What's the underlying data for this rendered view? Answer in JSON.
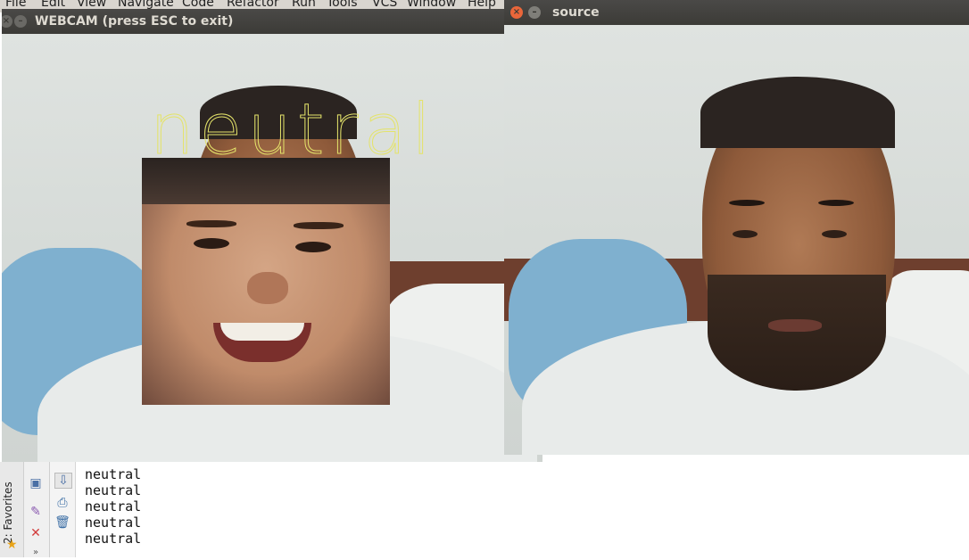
{
  "ide": {
    "menu": [
      "File",
      "Edit",
      "View",
      "Navigate",
      "Code",
      "Refactor",
      "Run",
      "Tools",
      "VCS",
      "Window",
      "Help"
    ],
    "favorites_label": "2: Favorites",
    "console_lines": [
      "neutral",
      "neutral",
      "neutral",
      "neutral",
      "neutral"
    ]
  },
  "webcam_window": {
    "title": "WEBCAM (press ESC to exit)",
    "emotion_label": "neutral"
  },
  "source_window": {
    "title": "source"
  },
  "colors": {
    "title_bar": "#3c3b37",
    "close_button": "#e9663a",
    "emotion_label": "#e4e36a",
    "headboard": "#6e3f2e",
    "pillow": "#7fb0cf"
  }
}
